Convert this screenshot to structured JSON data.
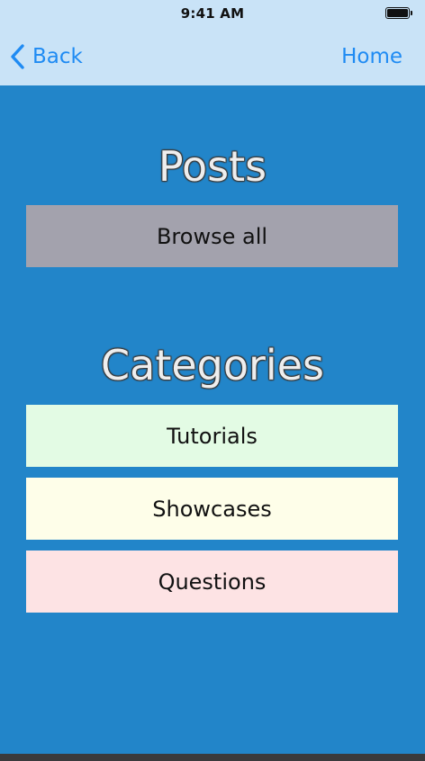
{
  "status_bar": {
    "time": "9:41 AM",
    "battery_icon": "battery-full-icon"
  },
  "nav": {
    "back_label": "Back",
    "back_icon": "chevron-left-icon",
    "home_label": "Home"
  },
  "posts": {
    "title": "Posts",
    "browse_all_label": "Browse all"
  },
  "categories": {
    "title": "Categories",
    "items": [
      {
        "label": "Tutorials",
        "color": "#e3fbe4"
      },
      {
        "label": "Showcases",
        "color": "#fefee9"
      },
      {
        "label": "Questions",
        "color": "#fde3e4"
      }
    ]
  },
  "colors": {
    "background": "#2285c9",
    "nav_background": "#c9e3f7",
    "accent": "#1f8bf3",
    "browse_all_button": "#a3a2ad"
  }
}
